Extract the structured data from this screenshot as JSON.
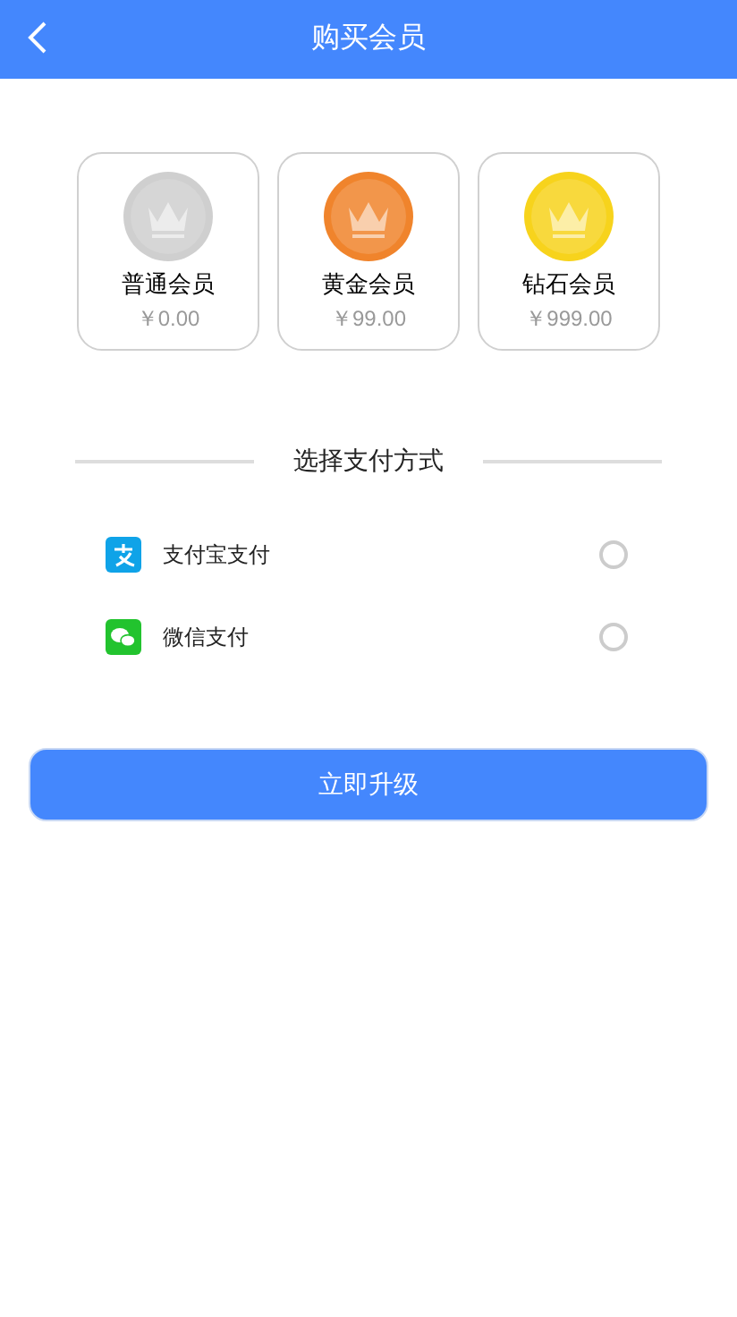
{
  "header": {
    "title": "购买会员"
  },
  "tiers": [
    {
      "name": "普通会员",
      "price": "￥0.00",
      "color": "#cfcfcf"
    },
    {
      "name": "黄金会员",
      "price": "￥99.00",
      "color": "#f0842c"
    },
    {
      "name": "钻石会员",
      "price": "￥999.00",
      "color": "#f7d31c"
    }
  ],
  "payment": {
    "title": "选择支付方式",
    "methods": [
      {
        "kind": "alipay",
        "label": "支付宝支付",
        "selected": false
      },
      {
        "kind": "wechat",
        "label": "微信支付",
        "selected": false
      }
    ]
  },
  "submit": {
    "label": "立即升级"
  }
}
